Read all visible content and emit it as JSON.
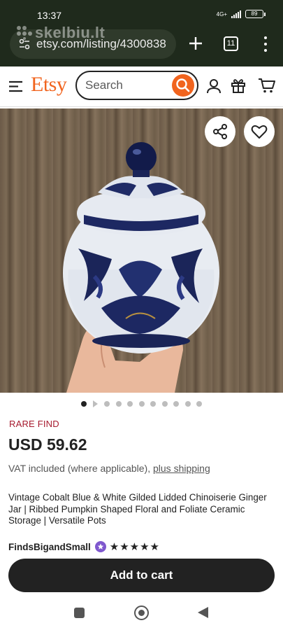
{
  "status_bar": {
    "time": "13:37",
    "network": "4G+",
    "battery": "89"
  },
  "browser": {
    "url": "etsy.com/listing/4300838",
    "watermark": "skelbiu.lt",
    "tab_count": "11"
  },
  "etsy_header": {
    "logo": "Etsy",
    "search_placeholder": "Search"
  },
  "carousel": {
    "total_dots": 11,
    "active_index": 0
  },
  "listing": {
    "badge": "RARE FIND",
    "price": "USD 59.62",
    "vat_text": "VAT included (where applicable), ",
    "shipping_link": "plus shipping",
    "title": "Vintage Cobalt Blue & White Gilded Lidded Chinoiserie Ginger Jar | Ribbed Pumpkin Shaped Floral and Foliate Ceramic Storage | Versatile Pots",
    "seller": "FindsBigandSmall",
    "stars": "★★★★★",
    "rating": 5,
    "add_to_cart": "Add to cart"
  },
  "colors": {
    "etsy_orange": "#f1641e",
    "badge_red": "#a61a2e",
    "star_seller_purple": "#7f58ce",
    "button_dark": "#222222"
  }
}
